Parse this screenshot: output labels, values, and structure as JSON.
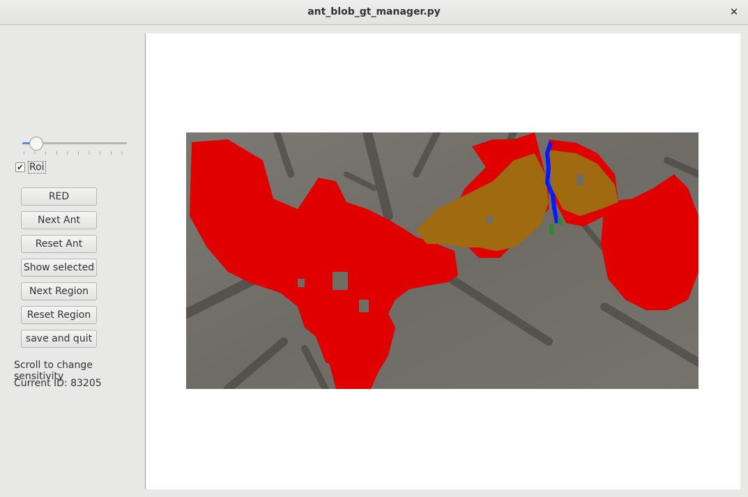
{
  "window": {
    "title": "ant_blob_gt_manager.py",
    "close_icon": "close-icon"
  },
  "sidebar": {
    "sensitivity_slider": {
      "value": 0.13
    },
    "roi_checkbox": {
      "label": "Roi",
      "checked": true
    },
    "buttons": [
      {
        "label": "RED"
      },
      {
        "label": "Next Ant"
      },
      {
        "label": "Reset Ant"
      },
      {
        "label": "Show selected"
      },
      {
        "label": "Next Region"
      },
      {
        "label": "Reset Region"
      },
      {
        "label": "save and quit"
      }
    ],
    "hint_text": "Scroll to change sensitivity",
    "current_id_text": "Current ID: 83205"
  },
  "colors": {
    "accent": "#4a90d9",
    "segmentation_red": "#e00000",
    "segmentation_orange": "#a06a10",
    "boundary_blue": "#0a1aff",
    "marker_green": "#2c8a2c"
  }
}
